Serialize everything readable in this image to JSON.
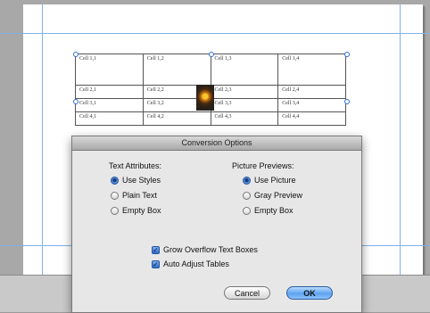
{
  "table": {
    "rows": [
      [
        "Cell 1,1",
        "Cell 1,2",
        "Cell 1,3",
        "Cell 1,4"
      ],
      [
        "Cell 2,1",
        "Cell 2,2",
        "Cell 2,3",
        "Cell 2,4"
      ],
      [
        "Cell 3,1",
        "Cell 3,2",
        "Cell 3,3",
        "Cell 3,4"
      ],
      [
        "Cell 4,1",
        "Cell 4,2",
        "Cell 4,3",
        "Cell 4,4"
      ]
    ]
  },
  "dialog": {
    "title": "Conversion Options",
    "text_attributes": {
      "label": "Text Attributes:",
      "options": [
        "Use Styles",
        "Plain Text",
        "Empty Box"
      ],
      "selected": "Use Styles"
    },
    "picture_previews": {
      "label": "Picture Previews:",
      "options": [
        "Use Picture",
        "Gray Preview",
        "Empty Box"
      ],
      "selected": "Use Picture"
    },
    "checkboxes": [
      {
        "label": "Grow Overflow Text Boxes",
        "checked": true
      },
      {
        "label": "Auto Adjust Tables",
        "checked": true
      }
    ],
    "cancel_label": "Cancel",
    "ok_label": "OK"
  },
  "icons": {
    "checkmark": "check-icon",
    "radio": "radio-icon",
    "picture": "photo-thumbnail"
  },
  "colors": {
    "guide": "#7fb2e6",
    "selection_handle": "#2b6fd6",
    "default_button": "#5ea3f0"
  }
}
